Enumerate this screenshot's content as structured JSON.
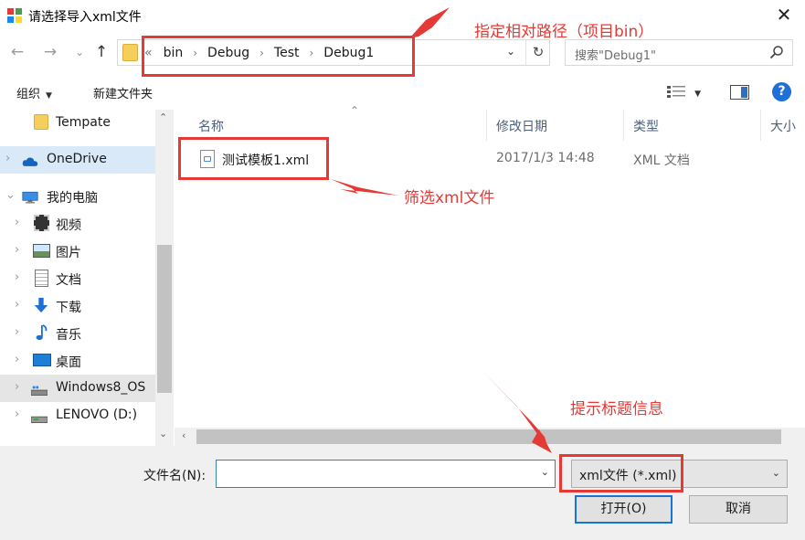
{
  "window": {
    "title": "请选择导入xml文件",
    "close_glyph": "✕"
  },
  "nav_buttons": {
    "back": "←",
    "forward": "→",
    "recent": "⌄",
    "up": "↑"
  },
  "address": {
    "overflow": "«",
    "crumbs": [
      "bin",
      "Debug",
      "Test",
      "Debug1"
    ],
    "dropdown": "⌄",
    "refresh": "↻"
  },
  "search": {
    "placeholder": "搜索\"Debug1\""
  },
  "toolbar": {
    "organize": "组织",
    "organize_caret": "▼",
    "new_folder": "新建文件夹",
    "view_caret": "▼",
    "help": "?"
  },
  "sidebar": {
    "items": [
      {
        "label": "Tempate",
        "icon": "folder-icon",
        "chevron": ""
      },
      {
        "label": "OneDrive",
        "icon": "cloud-icon",
        "chevron": "›"
      },
      {
        "label": "我的电脑",
        "icon": "computer-icon",
        "chevron": "⌄"
      },
      {
        "label": "视频",
        "icon": "video-icon",
        "chevron": "›"
      },
      {
        "label": "图片",
        "icon": "pictures-icon",
        "chevron": "›"
      },
      {
        "label": "文档",
        "icon": "documents-icon",
        "chevron": "›"
      },
      {
        "label": "下载",
        "icon": "download-icon",
        "chevron": "›"
      },
      {
        "label": "音乐",
        "icon": "music-icon",
        "chevron": "›"
      },
      {
        "label": "桌面",
        "icon": "desktop-icon",
        "chevron": "›"
      },
      {
        "label": "Windows8_OS",
        "icon": "drive-icon",
        "chevron": "›"
      },
      {
        "label": "LENOVO (D:)",
        "icon": "drive-icon",
        "chevron": "›"
      }
    ],
    "scroll_up": "⌃",
    "scroll_down": "⌄"
  },
  "columns": [
    "名称",
    "修改日期",
    "类型",
    "大小"
  ],
  "sort_indicator": "⌃",
  "files": [
    {
      "name": "测试模板1.xml",
      "date": "2017/1/3 14:48",
      "type": "XML 文档"
    }
  ],
  "hscroll_left": "‹",
  "bottom": {
    "filename_label": "文件名(N):",
    "filename_value": "",
    "filename_dropdown": "⌄",
    "filter": "xml文件 (*.xml)",
    "filter_dropdown": "⌄",
    "open": "打开(O)",
    "cancel": "取消"
  },
  "annotations": {
    "relative_path": "指定相对路径（项目bin）",
    "filter_xml": "筛选xml文件",
    "title_info": "提示标题信息",
    "color": "#e53935"
  },
  "colors": {
    "selected_item": "#d9e9f7",
    "hover_item": "#e5e5e5",
    "column_header": "#4c607a",
    "primary_button_border": "#1874d2",
    "help_blue": "#1e6fd6",
    "folder_yellow": "#f5cf5d"
  }
}
